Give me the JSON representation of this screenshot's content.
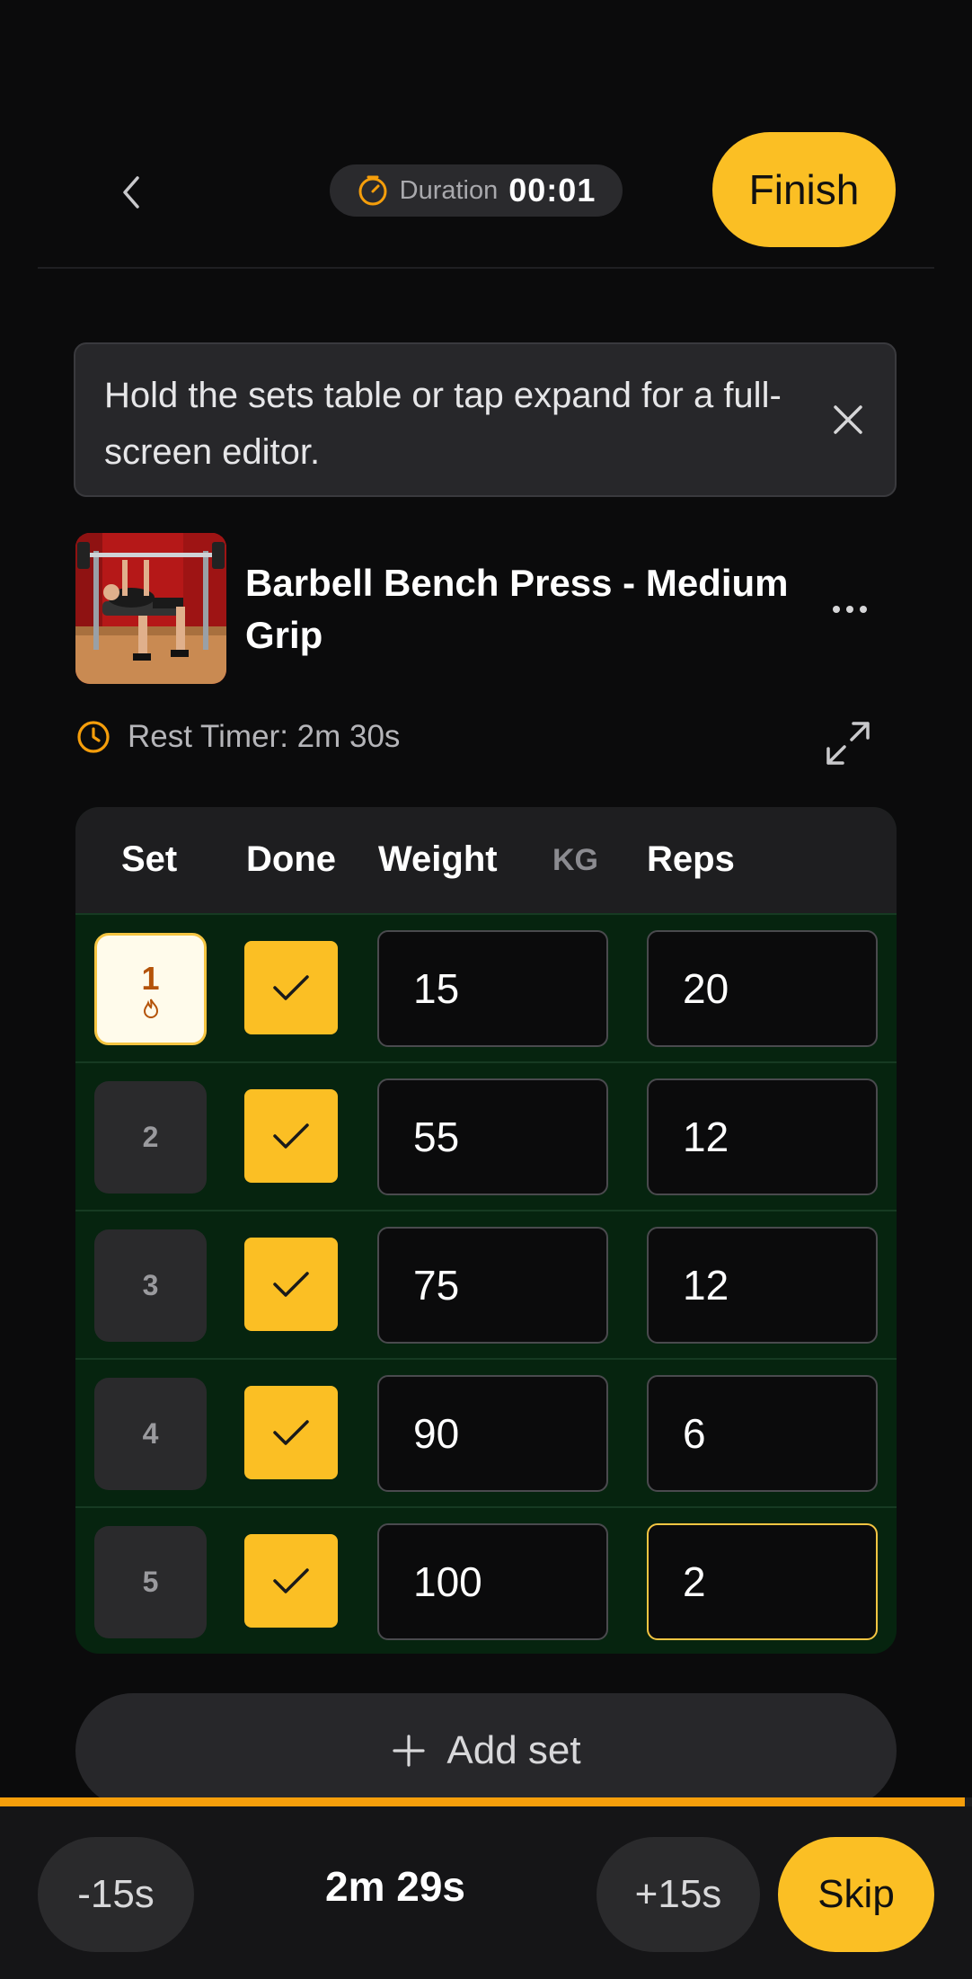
{
  "header": {
    "duration_label": "Duration",
    "duration_value": "00:01",
    "finish_label": "Finish"
  },
  "tip": {
    "text": "Hold the sets table or tap expand for a full-screen editor."
  },
  "exercise": {
    "name": "Barbell Bench Press - Medium Grip",
    "rest_timer_label": "Rest Timer: 2m 30s"
  },
  "table": {
    "headers": {
      "set": "Set",
      "done": "Done",
      "weight": "Weight",
      "unit": "KG",
      "reps": "Reps"
    },
    "rows": [
      {
        "set": "1",
        "warmup": true,
        "done": true,
        "weight": "15",
        "reps": "20"
      },
      {
        "set": "2",
        "warmup": false,
        "done": true,
        "weight": "55",
        "reps": "12"
      },
      {
        "set": "3",
        "warmup": false,
        "done": true,
        "weight": "75",
        "reps": "12"
      },
      {
        "set": "4",
        "warmup": false,
        "done": true,
        "weight": "90",
        "reps": "6"
      },
      {
        "set": "5",
        "warmup": false,
        "done": true,
        "weight": "100",
        "reps": "2"
      }
    ]
  },
  "add_set_label": "Add set",
  "rest_bar": {
    "minus_label": "-15s",
    "remaining": "2m 29s",
    "plus_label": "+15s",
    "skip_label": "Skip",
    "progress_fraction": 0.993
  },
  "colors": {
    "accent": "#fbbf24",
    "background": "#0b0b0c",
    "completed_row": "#06240f",
    "warmup_text": "#b45309"
  }
}
